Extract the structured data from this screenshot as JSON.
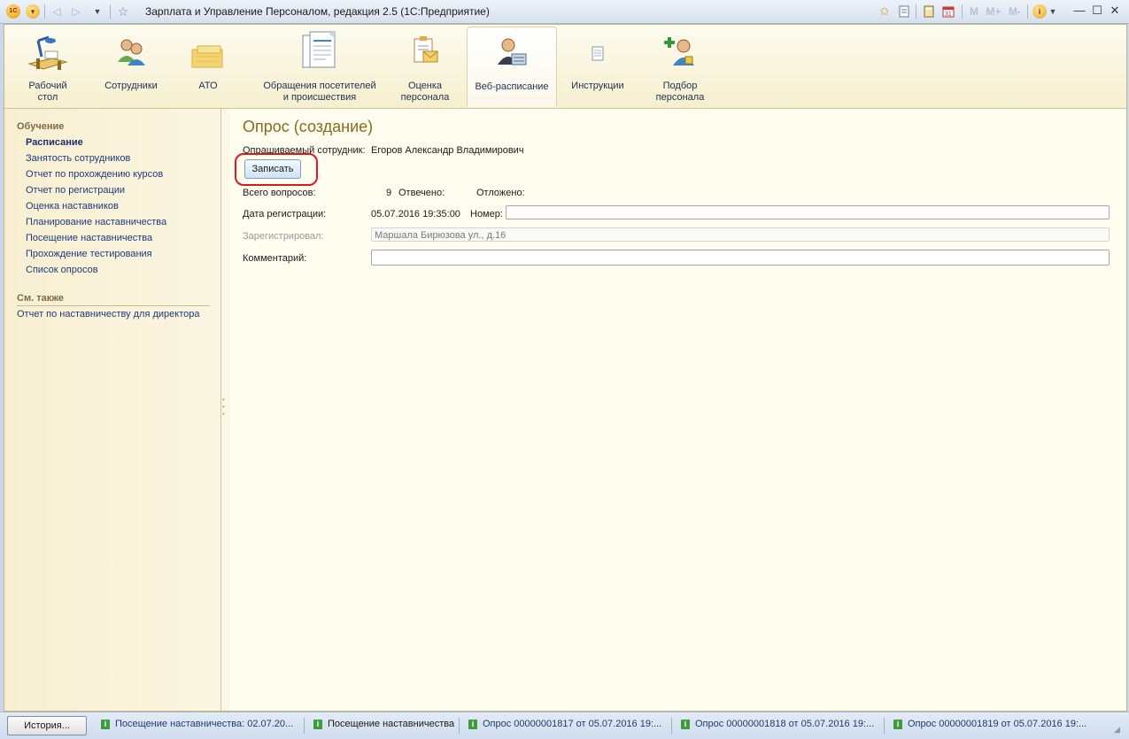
{
  "titlebar": {
    "title": "Зарплата и Управление Персоналом, редакция 2.5  (1С:Предприятие)",
    "memo_labels": [
      "M",
      "M+",
      "M-"
    ]
  },
  "sections": [
    {
      "label": "Рабочий\nстол",
      "icon": "desk-icon"
    },
    {
      "label": "Сотрудники",
      "icon": "employees-icon"
    },
    {
      "label": "АТО",
      "icon": "ato-icon"
    },
    {
      "label": "Обращения посетителей\nи происшествия",
      "icon": "documents-icon"
    },
    {
      "label": "Оценка\nперсонала",
      "icon": "evaluation-icon"
    },
    {
      "label": "Веб-расписание",
      "icon": "web-schedule-icon",
      "active": true
    },
    {
      "label": "Инструкции",
      "icon": "instructions-icon"
    },
    {
      "label": "Подбор\nперсонала",
      "icon": "recruitment-icon"
    }
  ],
  "nav": {
    "group_title": "Обучение",
    "items": [
      "Расписание",
      "Занятость сотрудников",
      "Отчет по прохождению курсов",
      "Отчет по регистрации",
      "Оценка наставников",
      "Планирование наставничества",
      "Посещение наставничества",
      "Прохождение тестирования",
      "Список опросов"
    ],
    "see_also_title": "См. также",
    "see_also_items": [
      "Отчет по наставничеству для директора"
    ]
  },
  "form": {
    "title": "Опрос (создание)",
    "employee_label": "Опрашиваемый сотрудник:",
    "employee_value": "Егоров Александр Владимирович",
    "save_label": "Записать",
    "total_label": "Всего вопросов:",
    "total_value": "9",
    "answered_label": "Отвечено:",
    "postponed_label": "Отложено:",
    "reg_date_label": "Дата регистрации:",
    "reg_date_value": "05.07.2016 19:35:00",
    "number_label": "Номер:",
    "number_value": "",
    "registered_by_label": "Зарегистрировал:",
    "registered_by_value": "Маршала Бирюзова ул., д.16",
    "comment_label": "Комментарий:",
    "comment_value": ""
  },
  "statusbar": {
    "history_label": "История...",
    "windows": [
      "Посещение наставничества: 02.07.20...",
      "Посещение наставничества",
      "Опрос 00000001817 от 05.07.2016 19:...",
      "Опрос 00000001818 от 05.07.2016 19:...",
      "Опрос 00000001819 от 05.07.2016 19:..."
    ]
  },
  "colors": {
    "accent_title": "#8a6a1c",
    "link": "#1f3a78",
    "highlight": "#e0181a"
  }
}
